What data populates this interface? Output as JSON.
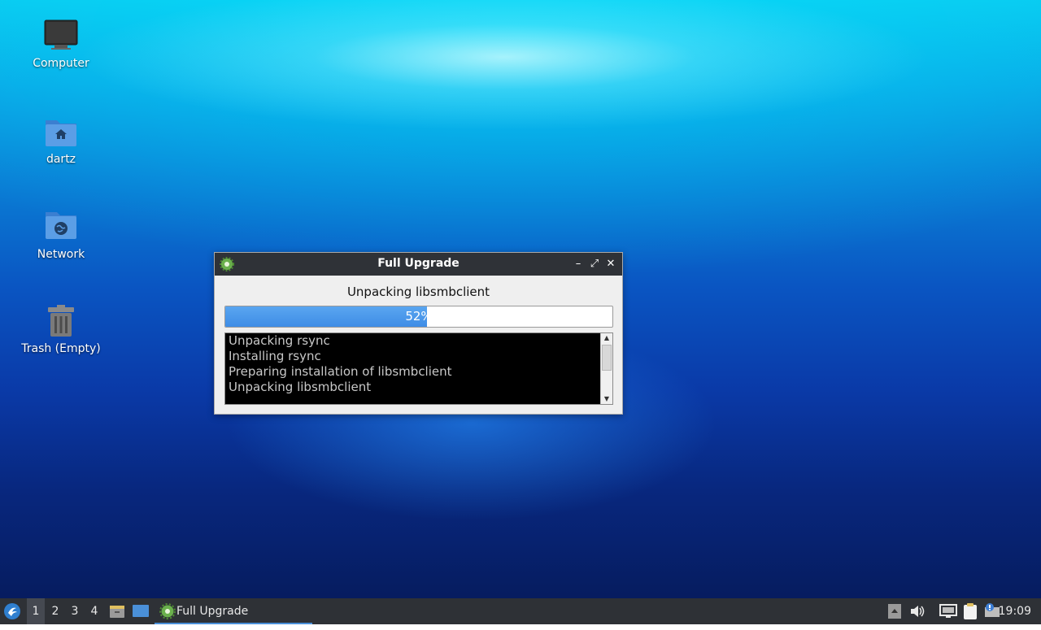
{
  "desktop": {
    "icons": [
      {
        "label": "Computer",
        "icon": "computer-icon"
      },
      {
        "label": "dartz",
        "icon": "home-folder-icon"
      },
      {
        "label": "Network",
        "icon": "network-folder-icon"
      },
      {
        "label": "Trash (Empty)",
        "icon": "trash-icon"
      }
    ]
  },
  "dialog": {
    "title": "Full Upgrade",
    "status": "Unpacking libsmbclient",
    "progress_percent": 52,
    "progress_label": "52%",
    "log_lines": [
      "Unpacking rsync",
      "Installing rsync",
      "Preparing installation of libsmbclient",
      "Unpacking libsmbclient"
    ],
    "buttons": {
      "minimize": "–",
      "maximize": "⤢",
      "close": "✕"
    }
  },
  "taskbar": {
    "workspaces": [
      "1",
      "2",
      "3",
      "4"
    ],
    "active_workspace": "1",
    "task_label": "Full Upgrade",
    "clock": "19:09"
  },
  "colors": {
    "accent": "#4a90d9",
    "progress": "#3e8de6",
    "titlebar": "#2f3237",
    "taskbar": "#2e3136"
  }
}
